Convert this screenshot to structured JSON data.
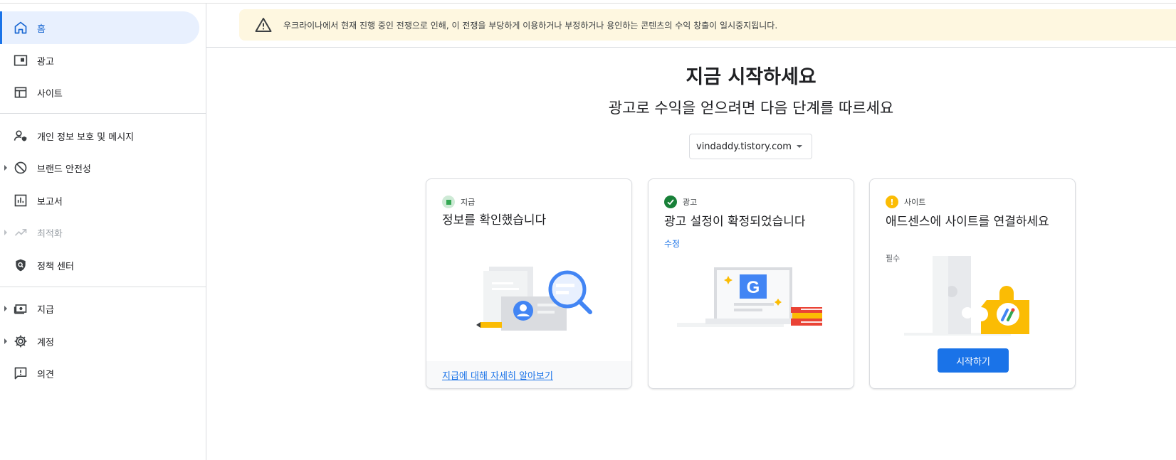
{
  "sidebar": {
    "items": [
      {
        "label": "홈",
        "icon": "home-icon"
      },
      {
        "label": "광고",
        "icon": "ads-icon"
      },
      {
        "label": "사이트",
        "icon": "sites-icon"
      },
      {
        "label": "개인 정보 보호 및 메시지",
        "icon": "privacy-messaging-icon"
      },
      {
        "label": "브랜드 안전성",
        "icon": "block-icon"
      },
      {
        "label": "보고서",
        "icon": "reports-icon"
      },
      {
        "label": "최적화",
        "icon": "trending-icon"
      },
      {
        "label": "정책 센터",
        "icon": "policy-shield-icon"
      },
      {
        "label": "지급",
        "icon": "payments-icon"
      },
      {
        "label": "계정",
        "icon": "gear-icon"
      },
      {
        "label": "의견",
        "icon": "feedback-icon"
      }
    ]
  },
  "notice": {
    "text": "우크라이나에서 현재 진행 중인 전쟁으로 인해, 이 전쟁을 부당하게 이용하거나 부정하거나 용인하는 콘텐츠의 수익 창출이 일시중지됩니다."
  },
  "main": {
    "title": "지금 시작하세요",
    "subtitle": "광고로 수익을 얻으려면 다음 단계를 따르세요",
    "site_select": "vindaddy.tistory.com"
  },
  "cards": [
    {
      "status": "지급",
      "title": "정보를 확인했습니다",
      "footer_link": "지급에 대해 자세히 알아보기"
    },
    {
      "status": "광고",
      "title": "광고 설정이 확정되었습니다",
      "link": "수정"
    },
    {
      "status": "사이트",
      "title": "애드센스에 사이트를 연결하세요",
      "note": "필수",
      "button": "시작하기"
    }
  ],
  "colors": {
    "accent": "#1a73e8",
    "success": "#188038",
    "warning": "#fbbc04",
    "notice_bg": "#fef7e0"
  }
}
